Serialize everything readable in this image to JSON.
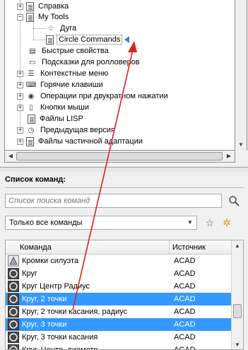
{
  "tree": {
    "items": [
      {
        "label": "Справка",
        "icon": "document-icon",
        "expander": "+"
      },
      {
        "label": "My Tools",
        "icon": "document-icon",
        "expander": "−"
      },
      {
        "label": "Дуга",
        "icon": "star-icon"
      },
      {
        "label": "Circle Commands",
        "icon": "document-icon"
      },
      {
        "label": "Быстрые свойства",
        "icon": "quick-properties-icon"
      },
      {
        "label": "Подсказки для ролловеров",
        "icon": "rollover-tooltip-icon"
      },
      {
        "label": "Контекстные меню",
        "icon": "context-menu-icon",
        "expander": "+"
      },
      {
        "label": "Горячие клавиши",
        "icon": "keyboard-icon",
        "expander": "+"
      },
      {
        "label": "Операции при двукратном нажатии",
        "icon": "double-click-icon",
        "expander": "+"
      },
      {
        "label": "Кнопки мыши",
        "icon": "mouse-icon",
        "expander": "+"
      },
      {
        "label": "Файлы LISP",
        "icon": "lisp-file-icon"
      },
      {
        "label": "Предыдущая версия",
        "icon": "clock-icon",
        "expander": "+"
      },
      {
        "label": "Файлы частичной адаптации",
        "icon": "cui-file-icon",
        "expander": "+"
      }
    ]
  },
  "command_list": {
    "header": "Список команд:",
    "search_placeholder": "Список поиска команд",
    "filter_value": "Только все команды",
    "columns": [
      "Команда",
      "Источник"
    ],
    "rows": [
      {
        "name": "Кромки силуэта",
        "source": "ACAD",
        "selected": false,
        "icon": "silhouette-icon"
      },
      {
        "name": "Круг",
        "source": "ACAD",
        "selected": false,
        "icon": "circle-icon"
      },
      {
        "name": "Круг Центр Радиус",
        "source": "ACAD",
        "selected": false,
        "icon": "circle-icon"
      },
      {
        "name": "Круг, 2 точки",
        "source": "ACAD",
        "selected": true,
        "icon": "circle-icon"
      },
      {
        "name": "Круг, 2 точки касания, радиус",
        "source": "ACAD",
        "selected": false,
        "icon": "circle-icon"
      },
      {
        "name": "Круг, 3 точки",
        "source": "ACAD",
        "selected": true,
        "icon": "circle-icon"
      },
      {
        "name": "Круг, 3 точки касания",
        "source": "ACAD",
        "selected": false,
        "icon": "circle-icon"
      },
      {
        "name": "Круг, Центр, диаметр",
        "source": "ACAD",
        "selected": false,
        "icon": "circle-icon"
      }
    ]
  },
  "colors": {
    "selection": "#3399ff",
    "annotation_arrow": "#e02020",
    "drop_marker": "#3a7fd5"
  }
}
